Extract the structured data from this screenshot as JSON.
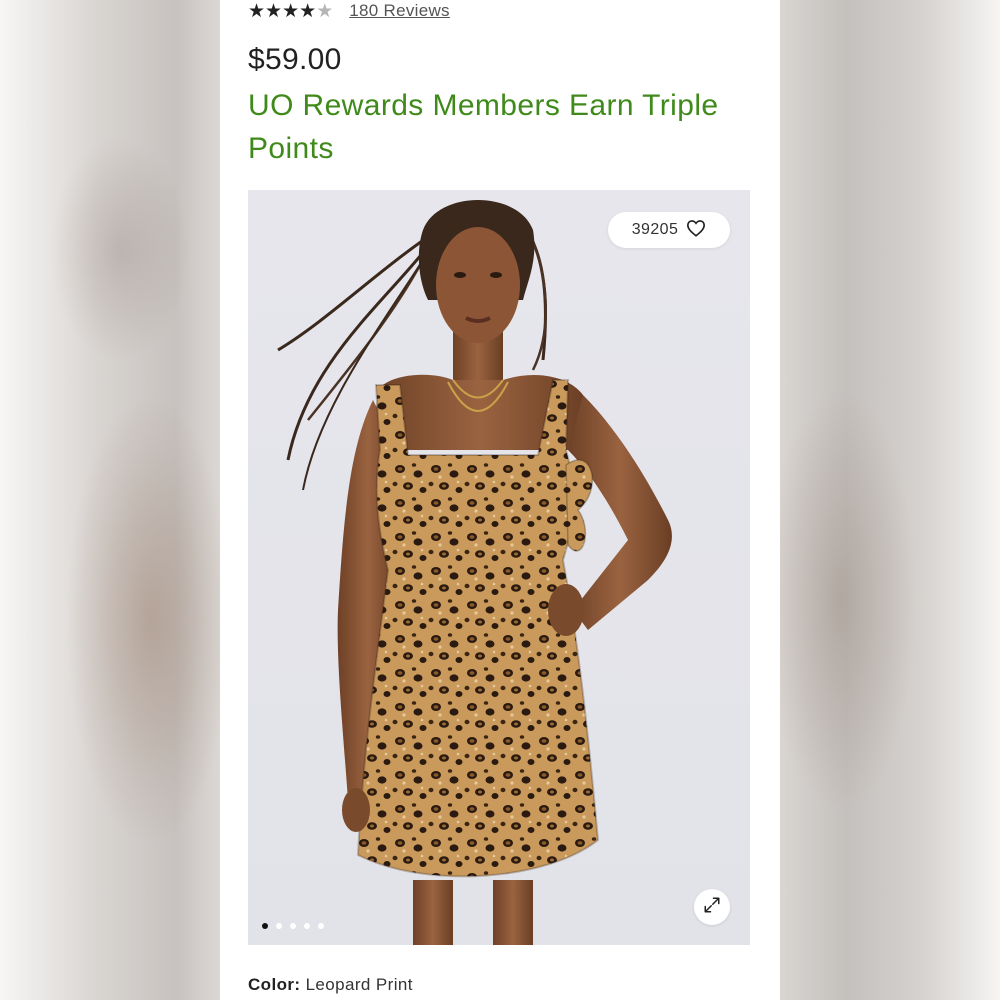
{
  "rating": {
    "stars": [
      "★",
      "★",
      "★",
      "★",
      "★"
    ],
    "value": 4.5,
    "reviews_label": "180 Reviews"
  },
  "price": "$59.00",
  "rewards_text": "UO Rewards Members Earn Triple Points",
  "gallery": {
    "like_count": "39205",
    "image_count": 5,
    "active_index": 0,
    "image_alt": "Model wearing leopard print mini dress"
  },
  "color": {
    "label": "Color:",
    "value": "Leopard Print"
  },
  "colors": {
    "rewards_green": "#3f8a1a",
    "text_dark": "#222222"
  }
}
